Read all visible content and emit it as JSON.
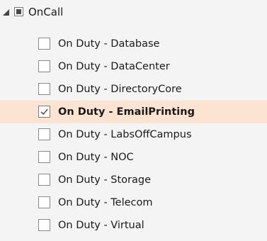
{
  "group": {
    "label": "OnCall",
    "state": "partial"
  },
  "items": [
    {
      "label": "On Duty - Database",
      "checked": false
    },
    {
      "label": "On Duty - DataCenter",
      "checked": false
    },
    {
      "label": "On Duty - DirectoryCore",
      "checked": false
    },
    {
      "label": "On Duty - EmailPrinting",
      "checked": true
    },
    {
      "label": "On Duty - LabsOffCampus",
      "checked": false
    },
    {
      "label": "On Duty - NOC",
      "checked": false
    },
    {
      "label": "On Duty - Storage",
      "checked": false
    },
    {
      "label": "On Duty - Telecom",
      "checked": false
    },
    {
      "label": "On Duty - Virtual",
      "checked": false
    }
  ],
  "colors": {
    "panel_background": "#f4f4f4",
    "selected_row": "#fde3d2",
    "checkbox_border": "#8a8a8a"
  },
  "icons": {
    "expander": "expanded-triangle-icon",
    "group_state": "partial-checkbox-icon",
    "item_check": "checkmark-icon"
  }
}
